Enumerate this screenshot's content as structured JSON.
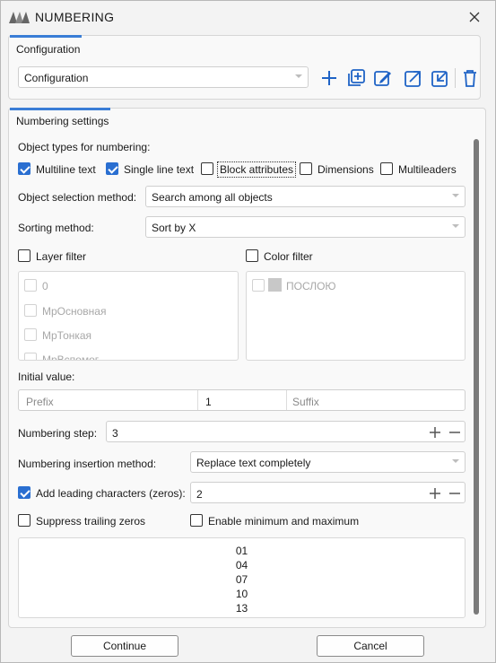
{
  "window": {
    "title": "NUMBERING"
  },
  "config_group": {
    "tab_label": "Configuration",
    "select_value": "Configuration"
  },
  "toolbar": {
    "icons": [
      "add-icon",
      "duplicate-icon",
      "edit-icon",
      "export-icon",
      "import-icon",
      "delete-icon"
    ]
  },
  "settings": {
    "tab_label": "Numbering settings",
    "object_types_label": "Object types for numbering:",
    "object_types": [
      {
        "label": "Multiline text",
        "checked": true
      },
      {
        "label": "Single line text",
        "checked": true
      },
      {
        "label": "Block attributes",
        "checked": false
      },
      {
        "label": "Dimensions",
        "checked": false
      },
      {
        "label": "Multileaders",
        "checked": false
      }
    ],
    "selection_method_label": "Object selection method:",
    "selection_method_value": "Search among all objects",
    "sorting_method_label": "Sorting method:",
    "sorting_method_value": "Sort by X",
    "layer_filter_label": "Layer filter",
    "layer_filter_checked": false,
    "layers": [
      "0",
      "МрОсновная",
      "МрТонкая",
      "МрВспомог"
    ],
    "color_filter_label": "Color filter",
    "color_filter_checked": false,
    "colors": [
      {
        "label": "ПОСЛОЮ",
        "swatch": "#c8c8c8"
      }
    ],
    "initial_value_label": "Initial value:",
    "prefix_placeholder": "Prefix",
    "initial_value": "1",
    "suffix_placeholder": "Suffix",
    "step_label": "Numbering step:",
    "step_value": "3",
    "insertion_method_label": "Numbering insertion method:",
    "insertion_method_value": "Replace text completely",
    "leading_chars_label": "Add leading characters (zeros):",
    "leading_chars_checked": true,
    "leading_chars_value": "2",
    "suppress_trailing_label": "Suppress trailing zeros",
    "suppress_trailing_checked": false,
    "min_max_label": "Enable minimum and maximum",
    "min_max_checked": false,
    "preview": [
      "01",
      "04",
      "07",
      "10",
      "13"
    ]
  },
  "buttons": {
    "continue": "Continue",
    "cancel": "Cancel"
  },
  "colors": {
    "accent": "#2a6fd1",
    "tab_underline": "#3a7dd6"
  }
}
